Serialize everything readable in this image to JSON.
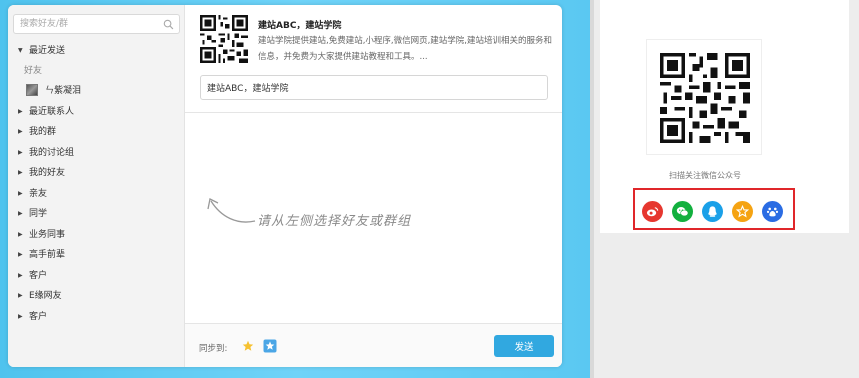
{
  "share_dialog": {
    "search_placeholder": "搜索好友/群",
    "tree": {
      "recent_group": "最近发送",
      "recent_subhead": "好友",
      "recent_friend": "ㄣ紫凝泪",
      "groups": [
        {
          "label": "最近联系人"
        },
        {
          "label": "我的群"
        },
        {
          "label": "我的讨论组"
        },
        {
          "label": "我的好友"
        },
        {
          "label": "亲友"
        },
        {
          "label": "同学"
        },
        {
          "label": "业务同事"
        },
        {
          "label": "高手前辈"
        },
        {
          "label": "客户"
        },
        {
          "label": "E缘网友"
        },
        {
          "label": "客户"
        }
      ]
    },
    "article": {
      "title": "建站ABC，建站学院",
      "description": "建站学院提供建站,免费建站,小程序,微信网页,建站学院,建站培训相关的服务和信息，并免费为大家提供建站教程和工具。..."
    },
    "comment_value": "建站ABC，建站学院",
    "hint_text": "请从左侧选择好友或群组",
    "sync_label": "同步到:",
    "send_label": "发送"
  },
  "right_page": {
    "scan_caption": "扫描关注微信公众号",
    "share_icons": [
      {
        "icon": "weibo-icon",
        "color": "#e6372f"
      },
      {
        "icon": "wechat-icon",
        "color": "#12b03e"
      },
      {
        "icon": "qq-icon",
        "color": "#1aa0e8"
      },
      {
        "icon": "qzone-icon",
        "color": "#f5a312"
      },
      {
        "icon": "baidu-icon",
        "color": "#2a6ce3"
      }
    ]
  },
  "colors": {
    "accent": "#31a8e0",
    "highlight_border": "#e0262a",
    "backdrop": "#5ac8f2"
  }
}
